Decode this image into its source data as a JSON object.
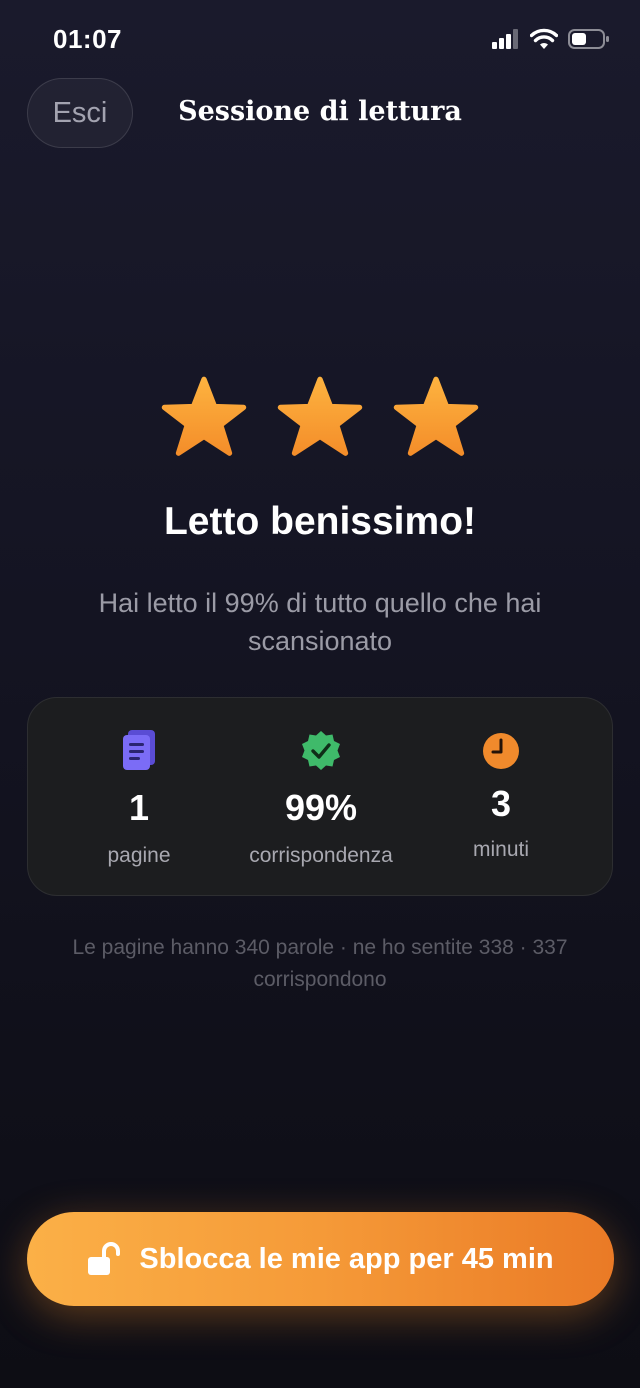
{
  "status_bar": {
    "time": "01:07"
  },
  "header": {
    "exit_label": "Esci",
    "title": "Sessione di lettura"
  },
  "result": {
    "star_count": 3,
    "headline": "Letto benissimo!",
    "subtitle": "Hai letto il 99% di tutto quello che hai scansionato"
  },
  "stats": [
    {
      "value": "1",
      "label": "pagine",
      "icon": "document-icon",
      "color": "#7b6cf6"
    },
    {
      "value": "99%",
      "label": "corrispondenza",
      "icon": "verified-badge-icon",
      "color": "#3fba6a"
    },
    {
      "value": "3",
      "label": "minuti",
      "icon": "clock-icon",
      "color": "#f08a2c"
    }
  ],
  "note": "Le pagine hanno 340 parole · ne ho sentite 338 · 337 corrispondono",
  "unlock_button": {
    "label": "Sblocca le mie app per 45 min",
    "icon": "unlock-icon"
  },
  "colors": {
    "accent": "#f59a38",
    "background": "#141422",
    "star": "#fbad3a"
  }
}
